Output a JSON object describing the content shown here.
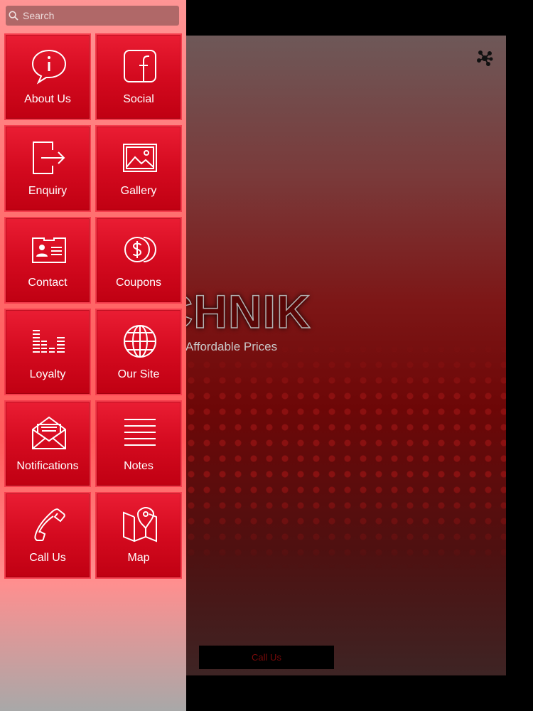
{
  "main": {
    "brand_text": "ITECHNIK",
    "tagline": "at Affordable Prices",
    "call_button_label": "Call Us",
    "share_icon": "share-network-icon",
    "colors": {
      "accent": "#d40a1f",
      "background": "#000000"
    }
  },
  "drawer": {
    "search": {
      "placeholder": "Search",
      "value": "",
      "icon": "search-icon"
    },
    "items": [
      {
        "label": "About Us",
        "icon": "info-speech-bubble-icon"
      },
      {
        "label": "Social",
        "icon": "facebook-icon"
      },
      {
        "label": "Enquiry",
        "icon": "exit-arrow-icon"
      },
      {
        "label": "Gallery",
        "icon": "picture-icon"
      },
      {
        "label": "Contact",
        "icon": "contact-card-icon"
      },
      {
        "label": "Coupons",
        "icon": "dollar-coins-icon"
      },
      {
        "label": "Loyalty",
        "icon": "loyalty-bars-icon"
      },
      {
        "label": "Our Site",
        "icon": "globe-icon"
      },
      {
        "label": "Notifications",
        "icon": "envelope-icon"
      },
      {
        "label": "Notes",
        "icon": "notes-lines-icon"
      },
      {
        "label": "Call Us",
        "icon": "phone-icon"
      },
      {
        "label": "Map",
        "icon": "map-pin-icon"
      }
    ]
  }
}
